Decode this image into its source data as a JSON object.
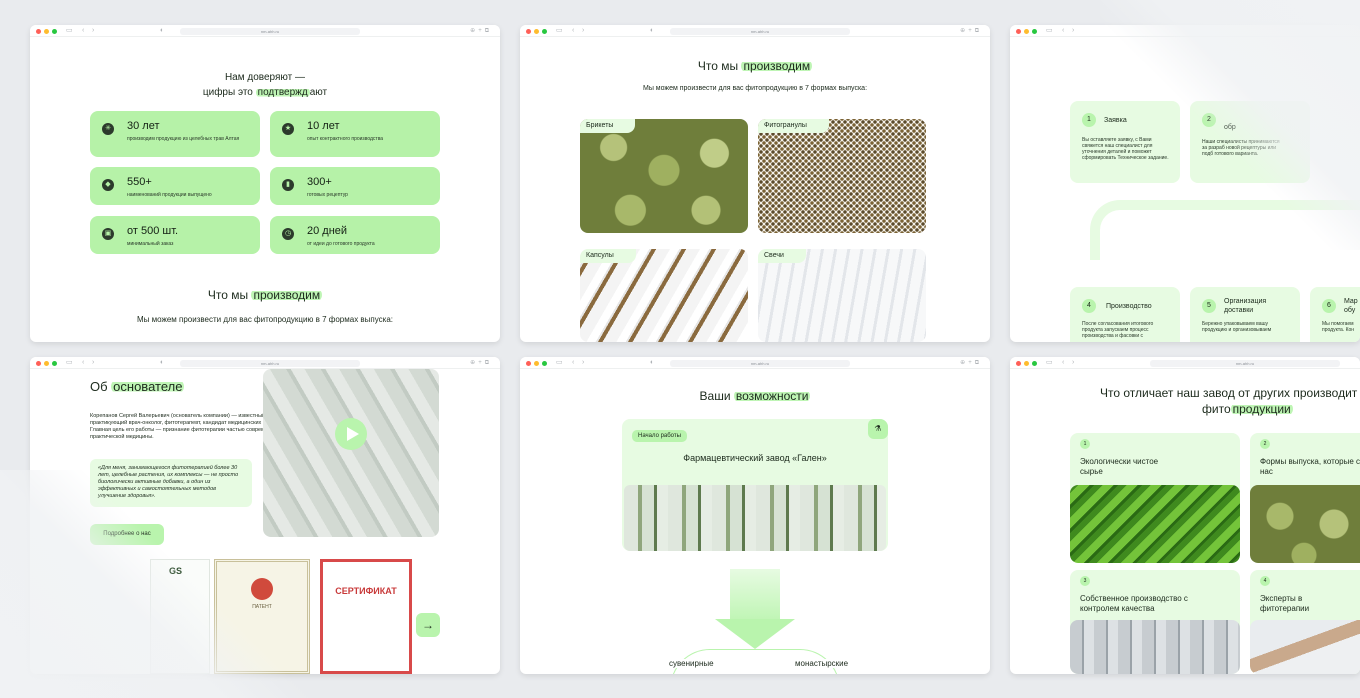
{
  "url": "nm-ahh.ru",
  "w1": {
    "title_line1": "Нам доверяют —",
    "title_pre": "цифры это ",
    "title_hl": "подтвержд",
    "title_post": "ают",
    "stats": [
      {
        "icon": "leaf-icon",
        "value": "30 лет",
        "desc": "производим продукцию из целебных трав Алтая"
      },
      {
        "icon": "star-icon",
        "value": "10 лет",
        "desc": "опыт контрактного производства"
      },
      {
        "icon": "tag-icon",
        "value": "550+",
        "desc": "наименований продукции выпущено"
      },
      {
        "icon": "jar-icon",
        "value": "300+",
        "desc": "готовых рецептур"
      },
      {
        "icon": "box-icon",
        "value": "от 500 шт.",
        "desc": "минимальный заказ"
      },
      {
        "icon": "clock-icon",
        "value": "20 дней",
        "desc": "от идеи до готового продукта"
      }
    ],
    "section_pre": "Что мы ",
    "section_hl": "производим",
    "section_sub": "Мы можем произвести для вас фитопродукцию в 7 формах выпуска:"
  },
  "w2": {
    "title_pre": "Что мы ",
    "title_hl": "производим",
    "subtitle": "Мы можем произвести для вас фитопродукцию в 7 формах выпуска:",
    "forms": [
      "Брикеты",
      "Фитогранулы",
      "Капсулы",
      "Свечи"
    ]
  },
  "w3": {
    "steps": [
      {
        "num": "1",
        "title": "Заявка",
        "desc": "Вы оставляете заявку, с Вами свяжется наш специалист для уточнения деталей и поможет сформировать Техническое задание."
      },
      {
        "num": "2",
        "title": "обр",
        "desc": "Наши специалисты принимаются за разраб новой рецептуры или подб готового варианта."
      },
      {
        "num": "4",
        "title": "Производство",
        "desc": "После согласования итогового продукта запускаем процесс производства и фасовки с"
      },
      {
        "num": "5",
        "title": "Организация доставки",
        "desc": "Бережно упаковываем вашу продукцию и организовываем"
      },
      {
        "num": "6",
        "title": "Мар обу",
        "desc": "Мы помогаем продукта. Кон"
      }
    ]
  },
  "w4": {
    "title_pre": "Об ",
    "title_hl": "основателе",
    "bio": "Корепанов Сергей Валерьевич (основатель компании) — известный практикующий врач-онколог, фитотерапевт, кандидат медицинских наук. Главная цель его работы — признание фитотерапии частью современной, практической медицины.",
    "quote": "«Для меня, занимающегося фитотерапией более 30 лет, целебные растения, их комплексы — не просто биологически активные добавки, а один из эффективных и самостоятельных методов улучшение здоровья».",
    "more": "Подробнее о нас",
    "docs": [
      "GS",
      "ПАТЕНТ",
      "СЕРТИФИКАТ"
    ],
    "next": "→"
  },
  "w5": {
    "title_pre": "Ваши ",
    "title_hl": "возможности",
    "badge": "Начало работы",
    "factory": "Фармацевтический завод «Гален»",
    "branches": [
      "сувенирные",
      "монастырские"
    ]
  },
  "w6": {
    "title_line1": "Что отличает наш завод от других производит",
    "title_pre": "фито",
    "title_hl": "продукции",
    "cards": [
      {
        "num": "1",
        "title": "Экологически чистое сырье"
      },
      {
        "num": "2",
        "title": "Формы выпуска, которые с нас"
      },
      {
        "num": "3",
        "title": "Собственное производство с контролем качества"
      },
      {
        "num": "4",
        "title": "Эксперты в фитотерапии"
      }
    ]
  }
}
